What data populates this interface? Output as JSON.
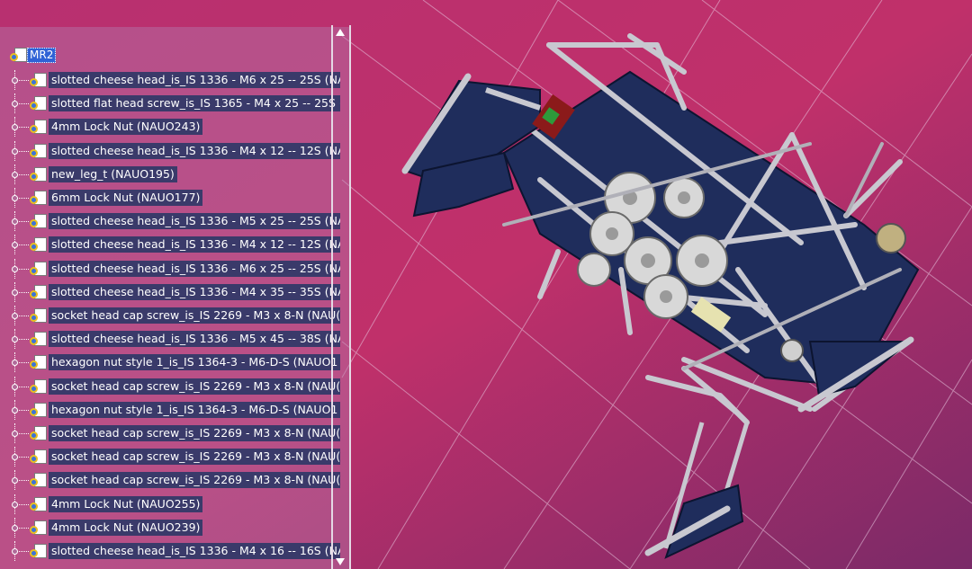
{
  "tree": {
    "root": {
      "label": "MR2",
      "icon": "product-icon"
    },
    "items": [
      {
        "label": "slotted cheese head_is_IS 1336 - M6 x 25 -- 25S (NA"
      },
      {
        "label": "slotted flat head screw_is_IS 1365 - M4 x 25 -- 25S ("
      },
      {
        "label": "4mm Lock Nut (NAUO243)"
      },
      {
        "label": "slotted cheese head_is_IS 1336 - M4 x 12 -- 12S (NA"
      },
      {
        "label": "new_leg_t (NAUO195)"
      },
      {
        "label": "6mm Lock Nut (NAUO177)"
      },
      {
        "label": "slotted cheese head_is_IS 1336 - M5 x 25 -- 25S (NA"
      },
      {
        "label": "slotted cheese head_is_IS 1336 - M4 x 12 -- 12S (NA"
      },
      {
        "label": "slotted cheese head_is_IS 1336 - M6 x 25 -- 25S (NA"
      },
      {
        "label": "slotted cheese head_is_IS 1336 - M4 x 35 -- 35S (NA"
      },
      {
        "label": "socket head cap screw_is_IS 2269 - M3 x 8-N (NAU("
      },
      {
        "label": "slotted cheese head_is_IS 1336 - M5 x 45 -- 38S (NA"
      },
      {
        "label": "hexagon nut style 1_is_IS 1364-3 - M6-D-S (NAUO1"
      },
      {
        "label": "socket head cap screw_is_IS 2269 - M3 x 8-N (NAU("
      },
      {
        "label": "hexagon nut style 1_is_IS 1364-3 - M6-D-S (NAUO1"
      },
      {
        "label": "socket head cap screw_is_IS 2269 - M3 x 8-N (NAU("
      },
      {
        "label": "socket head cap screw_is_IS 2269 - M3 x 8-N (NAU("
      },
      {
        "label": "socket head cap screw_is_IS 2269 - M3 x 8-N (NAU("
      },
      {
        "label": "4mm Lock Nut (NAUO255)"
      },
      {
        "label": "4mm Lock Nut (NAUO239)"
      },
      {
        "label": "slotted cheese head_is_IS 1336 - M4 x 16 -- 16S (NA"
      }
    ]
  },
  "colors": {
    "background": "#b02a6c",
    "label_bg": "#3a3a6a",
    "selection": "#2f62d6",
    "frame": "#c8c8d0",
    "panel": "#1f2d5c"
  }
}
